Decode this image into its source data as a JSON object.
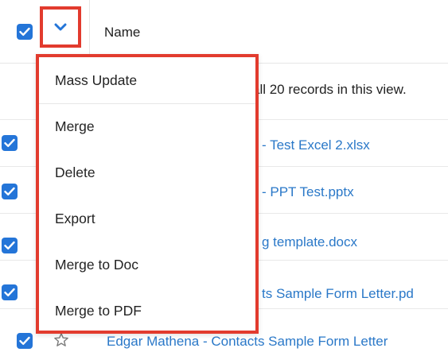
{
  "header": {
    "name_label": "Name"
  },
  "selection_note": "all 20 records in this view.",
  "rows": [
    {
      "link": "- Test Excel 2.xlsx"
    },
    {
      "link": "- PPT Test.pptx"
    },
    {
      "link": "g template.docx"
    },
    {
      "link": "ts Sample Form Letter.pd"
    },
    {
      "link": "Edgar Mathena - Contacts Sample Form Letter"
    }
  ],
  "menu": {
    "items": [
      "Mass Update",
      "Merge",
      "Delete",
      "Export",
      "Merge to Doc",
      "Merge to PDF"
    ]
  },
  "colors": {
    "accent": "#2475d8",
    "highlight": "#e23b2e",
    "link": "#2a78c8"
  }
}
